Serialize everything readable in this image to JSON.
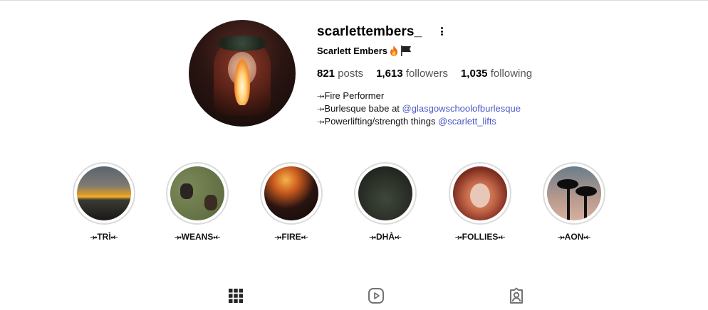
{
  "profile": {
    "username": "scarlettembers_",
    "full_name": "Scarlett Embers",
    "stats": {
      "posts_count": "821",
      "posts_label": "posts",
      "followers_count": "1,613",
      "followers_label": "followers",
      "following_count": "1,035",
      "following_label": "following"
    },
    "bio": {
      "line1": "⤞Fire Performer",
      "line2_prefix": "⤞Burlesque babe at ",
      "line2_link": "@glasgowschoolofburlesque",
      "line3_prefix": "⤞Powerlifting/strength things ",
      "line3_link": "@scarlett_lifts"
    },
    "link_color": "#4b59c7"
  },
  "highlights": [
    {
      "label": "⤞TRÌ⤝"
    },
    {
      "label": "⤞WEANS⤝"
    },
    {
      "label": "⤞FIRE⤝"
    },
    {
      "label": "⤞DHÀ⤝"
    },
    {
      "label": "⤞FOLLIES⤝"
    },
    {
      "label": "⤞AON⤝"
    }
  ],
  "icons": {
    "more": "more-options-icon",
    "fire": "fire-emoji-icon",
    "flag": "black-flag-icon",
    "grid": "grid-icon",
    "reels": "reels-icon",
    "tagged": "tagged-icon"
  }
}
